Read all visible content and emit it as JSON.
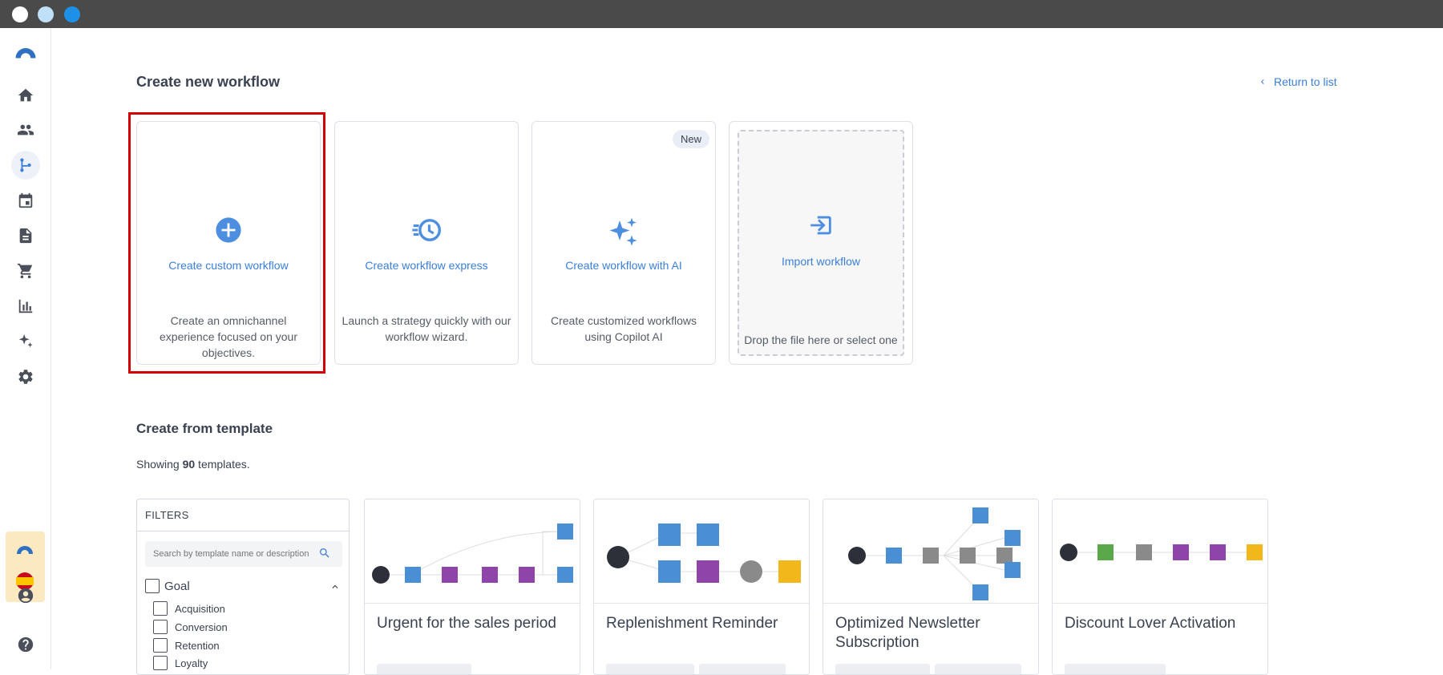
{
  "window": {
    "dots": [
      "#ffffff",
      "#bfe0f7",
      "#1e90e8"
    ]
  },
  "sidebar": {
    "items": [
      {
        "name": "home-icon"
      },
      {
        "name": "users-icon"
      },
      {
        "name": "workflow-icon",
        "active": true
      },
      {
        "name": "calendar-icon"
      },
      {
        "name": "document-icon"
      },
      {
        "name": "cart-icon"
      },
      {
        "name": "bar-chart-icon"
      },
      {
        "name": "sparkles-icon"
      },
      {
        "name": "gear-icon"
      }
    ],
    "bottom": [
      "account-icon",
      "help-icon"
    ]
  },
  "header": {
    "title": "Create new workflow",
    "return_label": "Return to list"
  },
  "options": [
    {
      "title": "Create custom workflow",
      "desc": "Create an omnichannel experience focused on your objectives.",
      "icon": "plus-circle-icon"
    },
    {
      "title": "Create workflow express",
      "desc": "Launch a strategy quickly with our workflow wizard.",
      "icon": "clock-fast-icon"
    },
    {
      "title": "Create workflow with AI",
      "desc": "Create customized workflows using Copilot AI",
      "icon": "sparkles-icon",
      "badge": "New"
    },
    {
      "title": "Import workflow",
      "desc": "Drop the file here or select one",
      "icon": "import-icon"
    }
  ],
  "templates": {
    "title": "Create from template",
    "showing_prefix": "Showing ",
    "count": "90",
    "showing_suffix": " templates.",
    "filters": {
      "header": "FILTERS",
      "search_placeholder": "Search by template name or description",
      "group": "Goal",
      "items": [
        "Acquisition",
        "Conversion",
        "Retention",
        "Loyalty"
      ]
    },
    "cards": [
      {
        "name": "Urgent for the sales period"
      },
      {
        "name": "Replenishment Reminder"
      },
      {
        "name": "Optimized Newsletter Subscription"
      },
      {
        "name": "Discount Lover Activation"
      }
    ]
  },
  "colors": {
    "accent": "#3b7fd8",
    "highlight": "#d00000",
    "node_blue": "#4a8fd6",
    "node_purple": "#8e44a8",
    "node_gray": "#8a8a8a",
    "node_green": "#5aa84a",
    "node_yellow": "#f2b71a",
    "node_dark": "#2d3038"
  }
}
